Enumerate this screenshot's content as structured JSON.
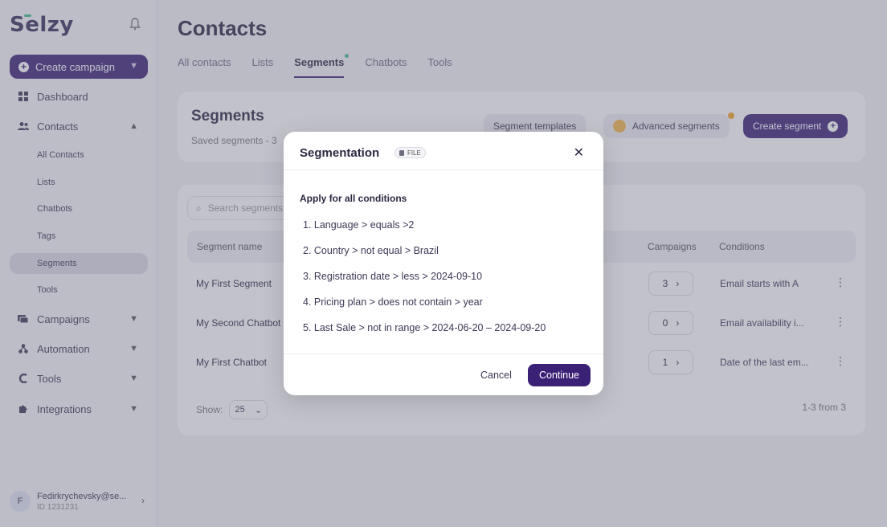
{
  "sidebar": {
    "logo": "Selzy",
    "create_campaign": "Create campaign",
    "nav": {
      "dashboard": "Dashboard",
      "contacts": "Contacts",
      "campaigns": "Campaigns",
      "automation": "Automation",
      "tools": "Tools",
      "integrations": "Integrations"
    },
    "contacts_sub": [
      "All Contacts",
      "Lists",
      "Chatbots",
      "Tags",
      "Segments",
      "Tools"
    ],
    "user": {
      "initial": "F",
      "email": "Fedirkrychevsky@se...",
      "id": "ID 1231231"
    }
  },
  "main": {
    "title": "Contacts",
    "tabs": [
      "All contacts",
      "Lists",
      "Segments",
      "Chatbots",
      "Tools"
    ],
    "segments_card": {
      "title": "Segments",
      "subtitle": "Saved segments - 3",
      "templates_btn": "Segment templates",
      "advanced_btn": "Advanced segments",
      "create_btn": "Create segment"
    },
    "table": {
      "search_placeholder": "Search segments",
      "headers": {
        "name": "Segment name",
        "campaigns": "Campaigns",
        "conditions": "Conditions"
      },
      "rows": [
        {
          "name": "My First Segment",
          "campaigns": "3",
          "conditions": "Email  starts with A"
        },
        {
          "name": "My Second Chatbot",
          "campaigns": "0",
          "conditions": "Email availability i..."
        },
        {
          "name": "My First Chatbot",
          "campaigns": "1",
          "conditions": "Date of the last em..."
        }
      ],
      "show_label": "Show:",
      "show_value": "25",
      "pager": "1-3 from 3"
    }
  },
  "modal": {
    "title": "Segmentation",
    "badge": "FILE",
    "subtitle": "Apply for all conditions",
    "conditions": [
      "1. Language > equals >2",
      "2. Country > not equal > Brazil",
      "3. Registration date > less > 2024-09-10",
      "4. Pricing plan > does not contain > year",
      "5. Last Sale > not in range > 2024-06-20 – 2024-09-20"
    ],
    "cancel": "Cancel",
    "continue": "Continue"
  },
  "colors": {
    "brand": "#3b2176",
    "accent_green": "#3fbf8b",
    "accent_orange": "#f5a623"
  }
}
